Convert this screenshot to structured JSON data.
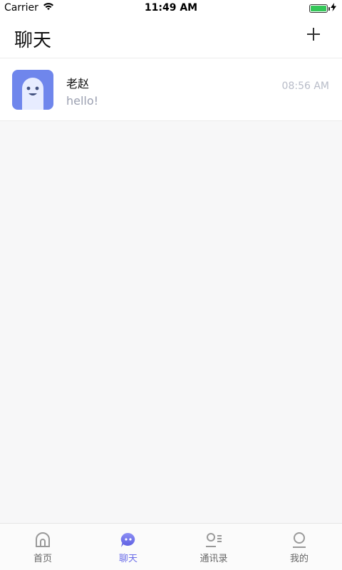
{
  "status_bar": {
    "carrier": "Carrier",
    "time": "11:49 AM",
    "battery_level": 1.0
  },
  "header": {
    "title": "聊天",
    "add_icon": "plus-icon"
  },
  "chats": [
    {
      "name": "老赵",
      "preview": "hello!",
      "time": "08:56 AM",
      "avatar_icon": "ghost-avatar-icon"
    }
  ],
  "tabs": [
    {
      "label": "首页",
      "icon": "home-icon",
      "active": false
    },
    {
      "label": "聊天",
      "icon": "chat-bubble-icon",
      "active": true
    },
    {
      "label": "通讯录",
      "icon": "contacts-icon",
      "active": false
    },
    {
      "label": "我的",
      "icon": "profile-icon",
      "active": false
    }
  ],
  "colors": {
    "accent": "#6b6de8",
    "avatar_bg": "#6f86ec",
    "battery": "#34c759"
  }
}
